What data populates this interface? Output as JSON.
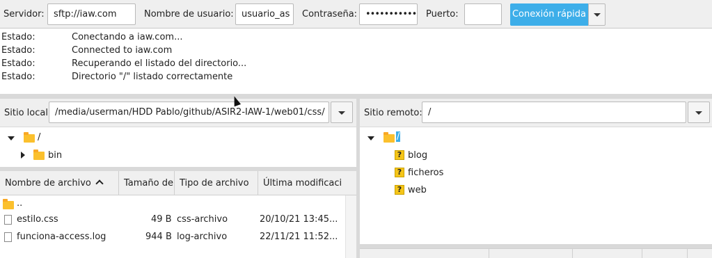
{
  "quickconnect": {
    "server_label": "Servidor:",
    "server_value": "sftp://iaw.com",
    "user_label": "Nombre de usuario:",
    "user_value": "usuario_as",
    "password_label": "Contraseña:",
    "password_value": "•••••••••••••",
    "port_label": "Puerto:",
    "port_value": "",
    "connect_label": "Conexión rápida"
  },
  "log": [
    {
      "key": "Estado:",
      "value": "Conectando a iaw.com..."
    },
    {
      "key": "Estado:",
      "value": "Connected to iaw.com"
    },
    {
      "key": "Estado:",
      "value": "Recuperando el listado del directorio..."
    },
    {
      "key": "Estado:",
      "value": "Directorio \"/\" listado correctamente"
    }
  ],
  "local": {
    "site_label": "Sitio local:",
    "site_value": "/media/userman/HDD Pablo/github/ASIR2-IAW-1/web01/css/",
    "tree": [
      {
        "label": "/"
      },
      {
        "label": "bin"
      }
    ],
    "columns": [
      "Nombre de archivo",
      "Tamaño de a",
      "Tipo de archivo",
      "Última modificación"
    ],
    "files": [
      {
        "name": "..",
        "size": "",
        "type": "",
        "modified": ""
      },
      {
        "name": "estilo.css",
        "size": "49 B",
        "type": "css-archivo",
        "modified": "20/10/21 13:45..."
      },
      {
        "name": "funciona-access.log",
        "size": "944 B",
        "type": "log-archivo",
        "modified": "22/11/21 11:52..."
      }
    ]
  },
  "remote": {
    "site_label": "Sitio remoto:",
    "site_value": "/",
    "tree": [
      {
        "label": "/"
      },
      {
        "label": "blog"
      },
      {
        "label": "ficheros"
      },
      {
        "label": "web"
      }
    ]
  },
  "colors": {
    "accent": "#3daee9",
    "folder": "#fbc02d"
  }
}
